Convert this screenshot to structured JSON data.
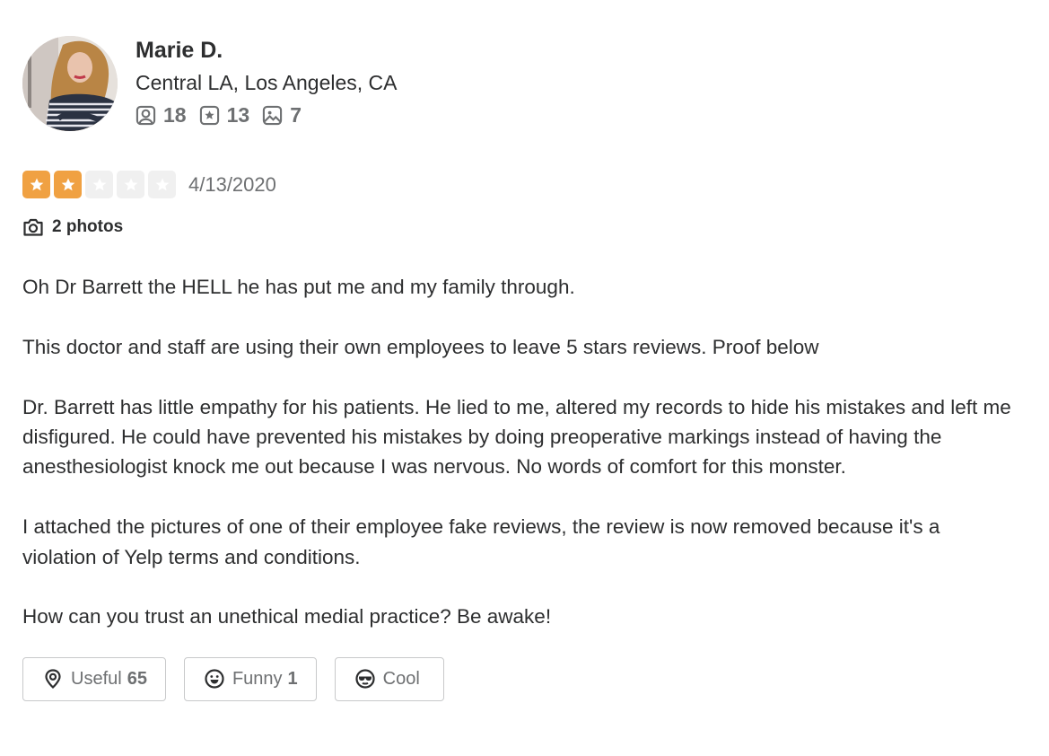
{
  "user": {
    "name": "Marie D.",
    "location": "Central LA, Los Angeles, CA",
    "avatar_icon": "user-photo",
    "stats": {
      "friends": {
        "icon": "friends-icon",
        "value": "18"
      },
      "reviews": {
        "icon": "review-star-icon",
        "value": "13"
      },
      "photos": {
        "icon": "photo-icon",
        "value": "7"
      }
    }
  },
  "rating": {
    "stars": 2,
    "max_stars": 5,
    "date": "4/13/2020",
    "color_on": "#f0a142",
    "color_off": "#f0f0f0"
  },
  "photos": {
    "icon": "camera-icon",
    "label": "2 photos"
  },
  "review": {
    "paragraphs": [
      "Oh Dr Barrett the HELL he has put me and my family through.",
      "This doctor and staff are using their own employees to leave 5 stars reviews. Proof below",
      "Dr. Barrett has little empathy for his patients. He lied to me, altered my records to hide his mistakes and left me disfigured. He could have prevented his mistakes by doing preoperative markings instead of having the anesthesiologist knock me out because I was nervous. No words of comfort for this monster.",
      "I attached the pictures of one of their employee fake reviews, the review is now removed because it's a violation of Yelp terms and conditions.",
      "How can you trust an unethical medial practice? Be awake!"
    ]
  },
  "reactions": {
    "useful": {
      "icon": "lightbulb-icon",
      "label": "Useful",
      "count": "65"
    },
    "funny": {
      "icon": "smile-icon",
      "label": "Funny",
      "count": "1"
    },
    "cool": {
      "icon": "sunglasses-icon",
      "label": "Cool",
      "count": ""
    }
  }
}
